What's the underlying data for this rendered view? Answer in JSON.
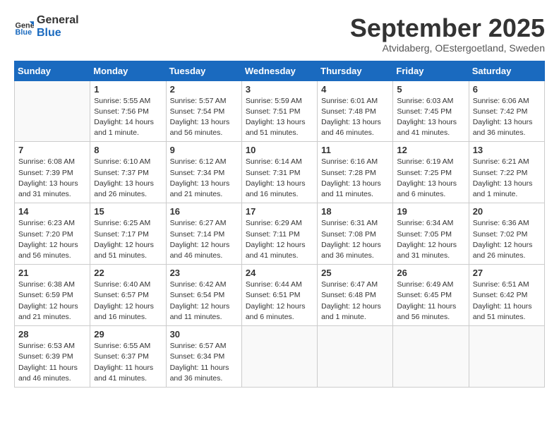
{
  "logo": {
    "general": "General",
    "blue": "Blue"
  },
  "header": {
    "month": "September 2025",
    "location": "Atvidaberg, OEstergoetland, Sweden"
  },
  "weekdays": [
    "Sunday",
    "Monday",
    "Tuesday",
    "Wednesday",
    "Thursday",
    "Friday",
    "Saturday"
  ],
  "weeks": [
    [
      {
        "day": "",
        "sunrise": "",
        "sunset": "",
        "daylight": ""
      },
      {
        "day": "1",
        "sunrise": "Sunrise: 5:55 AM",
        "sunset": "Sunset: 7:56 PM",
        "daylight": "Daylight: 14 hours and 1 minute."
      },
      {
        "day": "2",
        "sunrise": "Sunrise: 5:57 AM",
        "sunset": "Sunset: 7:54 PM",
        "daylight": "Daylight: 13 hours and 56 minutes."
      },
      {
        "day": "3",
        "sunrise": "Sunrise: 5:59 AM",
        "sunset": "Sunset: 7:51 PM",
        "daylight": "Daylight: 13 hours and 51 minutes."
      },
      {
        "day": "4",
        "sunrise": "Sunrise: 6:01 AM",
        "sunset": "Sunset: 7:48 PM",
        "daylight": "Daylight: 13 hours and 46 minutes."
      },
      {
        "day": "5",
        "sunrise": "Sunrise: 6:03 AM",
        "sunset": "Sunset: 7:45 PM",
        "daylight": "Daylight: 13 hours and 41 minutes."
      },
      {
        "day": "6",
        "sunrise": "Sunrise: 6:06 AM",
        "sunset": "Sunset: 7:42 PM",
        "daylight": "Daylight: 13 hours and 36 minutes."
      }
    ],
    [
      {
        "day": "7",
        "sunrise": "Sunrise: 6:08 AM",
        "sunset": "Sunset: 7:39 PM",
        "daylight": "Daylight: 13 hours and 31 minutes."
      },
      {
        "day": "8",
        "sunrise": "Sunrise: 6:10 AM",
        "sunset": "Sunset: 7:37 PM",
        "daylight": "Daylight: 13 hours and 26 minutes."
      },
      {
        "day": "9",
        "sunrise": "Sunrise: 6:12 AM",
        "sunset": "Sunset: 7:34 PM",
        "daylight": "Daylight: 13 hours and 21 minutes."
      },
      {
        "day": "10",
        "sunrise": "Sunrise: 6:14 AM",
        "sunset": "Sunset: 7:31 PM",
        "daylight": "Daylight: 13 hours and 16 minutes."
      },
      {
        "day": "11",
        "sunrise": "Sunrise: 6:16 AM",
        "sunset": "Sunset: 7:28 PM",
        "daylight": "Daylight: 13 hours and 11 minutes."
      },
      {
        "day": "12",
        "sunrise": "Sunrise: 6:19 AM",
        "sunset": "Sunset: 7:25 PM",
        "daylight": "Daylight: 13 hours and 6 minutes."
      },
      {
        "day": "13",
        "sunrise": "Sunrise: 6:21 AM",
        "sunset": "Sunset: 7:22 PM",
        "daylight": "Daylight: 13 hours and 1 minute."
      }
    ],
    [
      {
        "day": "14",
        "sunrise": "Sunrise: 6:23 AM",
        "sunset": "Sunset: 7:20 PM",
        "daylight": "Daylight: 12 hours and 56 minutes."
      },
      {
        "day": "15",
        "sunrise": "Sunrise: 6:25 AM",
        "sunset": "Sunset: 7:17 PM",
        "daylight": "Daylight: 12 hours and 51 minutes."
      },
      {
        "day": "16",
        "sunrise": "Sunrise: 6:27 AM",
        "sunset": "Sunset: 7:14 PM",
        "daylight": "Daylight: 12 hours and 46 minutes."
      },
      {
        "day": "17",
        "sunrise": "Sunrise: 6:29 AM",
        "sunset": "Sunset: 7:11 PM",
        "daylight": "Daylight: 12 hours and 41 minutes."
      },
      {
        "day": "18",
        "sunrise": "Sunrise: 6:31 AM",
        "sunset": "Sunset: 7:08 PM",
        "daylight": "Daylight: 12 hours and 36 minutes."
      },
      {
        "day": "19",
        "sunrise": "Sunrise: 6:34 AM",
        "sunset": "Sunset: 7:05 PM",
        "daylight": "Daylight: 12 hours and 31 minutes."
      },
      {
        "day": "20",
        "sunrise": "Sunrise: 6:36 AM",
        "sunset": "Sunset: 7:02 PM",
        "daylight": "Daylight: 12 hours and 26 minutes."
      }
    ],
    [
      {
        "day": "21",
        "sunrise": "Sunrise: 6:38 AM",
        "sunset": "Sunset: 6:59 PM",
        "daylight": "Daylight: 12 hours and 21 minutes."
      },
      {
        "day": "22",
        "sunrise": "Sunrise: 6:40 AM",
        "sunset": "Sunset: 6:57 PM",
        "daylight": "Daylight: 12 hours and 16 minutes."
      },
      {
        "day": "23",
        "sunrise": "Sunrise: 6:42 AM",
        "sunset": "Sunset: 6:54 PM",
        "daylight": "Daylight: 12 hours and 11 minutes."
      },
      {
        "day": "24",
        "sunrise": "Sunrise: 6:44 AM",
        "sunset": "Sunset: 6:51 PM",
        "daylight": "Daylight: 12 hours and 6 minutes."
      },
      {
        "day": "25",
        "sunrise": "Sunrise: 6:47 AM",
        "sunset": "Sunset: 6:48 PM",
        "daylight": "Daylight: 12 hours and 1 minute."
      },
      {
        "day": "26",
        "sunrise": "Sunrise: 6:49 AM",
        "sunset": "Sunset: 6:45 PM",
        "daylight": "Daylight: 11 hours and 56 minutes."
      },
      {
        "day": "27",
        "sunrise": "Sunrise: 6:51 AM",
        "sunset": "Sunset: 6:42 PM",
        "daylight": "Daylight: 11 hours and 51 minutes."
      }
    ],
    [
      {
        "day": "28",
        "sunrise": "Sunrise: 6:53 AM",
        "sunset": "Sunset: 6:39 PM",
        "daylight": "Daylight: 11 hours and 46 minutes."
      },
      {
        "day": "29",
        "sunrise": "Sunrise: 6:55 AM",
        "sunset": "Sunset: 6:37 PM",
        "daylight": "Daylight: 11 hours and 41 minutes."
      },
      {
        "day": "30",
        "sunrise": "Sunrise: 6:57 AM",
        "sunset": "Sunset: 6:34 PM",
        "daylight": "Daylight: 11 hours and 36 minutes."
      },
      {
        "day": "",
        "sunrise": "",
        "sunset": "",
        "daylight": ""
      },
      {
        "day": "",
        "sunrise": "",
        "sunset": "",
        "daylight": ""
      },
      {
        "day": "",
        "sunrise": "",
        "sunset": "",
        "daylight": ""
      },
      {
        "day": "",
        "sunrise": "",
        "sunset": "",
        "daylight": ""
      }
    ]
  ]
}
